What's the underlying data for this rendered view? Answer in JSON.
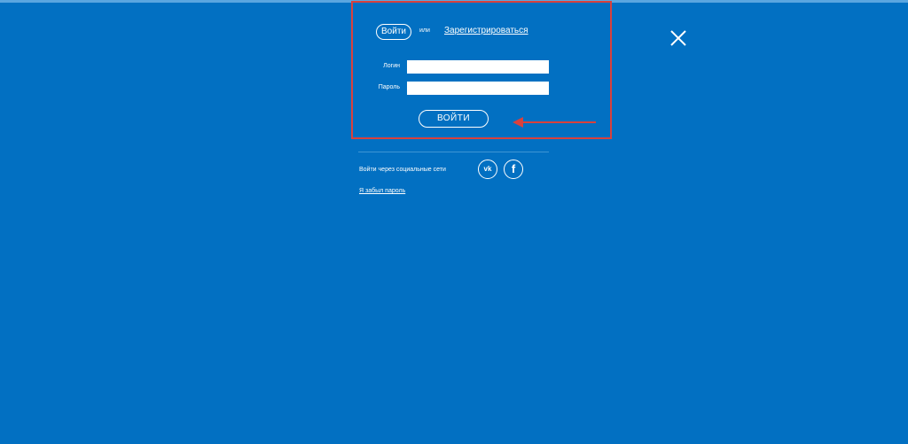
{
  "header": {
    "login_tab": "Войти",
    "or_text": "или",
    "register_link": "Зарегистрироваться"
  },
  "form": {
    "login_label": "Логин",
    "login_value": "",
    "password_label": "Пароль",
    "password_value": "",
    "submit_label": "ВОЙТИ"
  },
  "social": {
    "label": "Войти через социальные сети",
    "vk_glyph": "vk",
    "fb_glyph": "f"
  },
  "forgot_password": "Я забыл пароль",
  "icons": {
    "close": "close-icon",
    "vk": "vk-icon",
    "facebook": "facebook-icon",
    "arrow": "arrow-left-icon"
  },
  "colors": {
    "background": "#0270c2",
    "foreground": "#ffffff",
    "annotation": "#d9413d"
  }
}
